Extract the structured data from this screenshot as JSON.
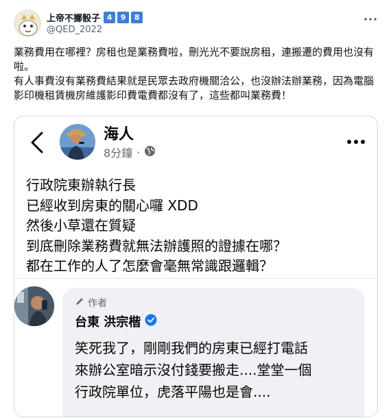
{
  "author": {
    "display_name": "上帝不擲骰子",
    "badges": [
      "4",
      "9",
      "8"
    ],
    "handle": "@QED_2022"
  },
  "icons": {
    "more": "more-horizontal-icon",
    "back": "back-chevron-icon",
    "globe": "globe-icon",
    "pencil": "pencil-icon",
    "verified": "verified-badge-icon"
  },
  "tweet": {
    "lines": [
      "業務費用在哪裡？房租也是業務費啦，刪光光不要說房租，連搬遷的費用也沒有啦。",
      "有人事費沒有業務費結果就是民眾去政府機關洽公，也沒辦法辦業務，因為電腦影印機租賃機房維護影印費電費都沒有了，這些都叫業務費！"
    ]
  },
  "embedded_post": {
    "name": "海人",
    "time": "8分鐘",
    "separator": "·",
    "body_lines": [
      "行政院東辦執行長",
      "已經收到房東的關心囉 XDD",
      "然後小草還在質疑",
      "到底刪除業務費就無法辦護照的證據在哪？",
      "都在工作的人了怎麼會毫無常識跟邏輯？"
    ],
    "comment": {
      "author_label": "作者",
      "name": "台東 洪宗楷",
      "text_lines": [
        "笑死我了，剛剛我們的房東已經打電話",
        "來辦公室暗示沒付錢要搬走....堂堂一個",
        "行政院單位，虎落平陽也是會...."
      ]
    }
  },
  "colors": {
    "badge": "#3f7fd4",
    "verified": "#1877f2",
    "bubble": "#eff1f4"
  }
}
